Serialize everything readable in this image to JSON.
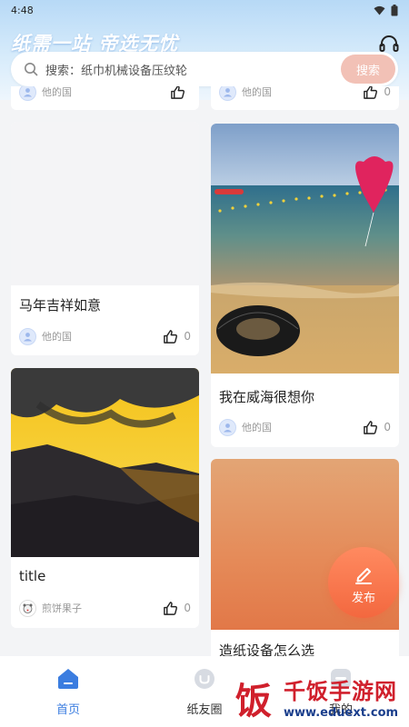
{
  "status_bar": {
    "time": "4:48"
  },
  "header": {
    "slogan": "纸需一站  帝选无忧"
  },
  "search": {
    "placeholder": "搜索：纸巾机械设备压纹轮",
    "button": "搜索"
  },
  "feed": {
    "cards": [
      {
        "title": "",
        "author": "他的国",
        "likes": ""
      },
      {
        "title": "",
        "author": "他的国",
        "likes": "0"
      },
      {
        "title": "马年吉祥如意",
        "author": "他的国",
        "likes": "0"
      },
      {
        "title": "我在威海很想你",
        "author": "他的国",
        "likes": "0"
      },
      {
        "title": "title",
        "author": "煎饼果子",
        "likes": "0"
      },
      {
        "title": "造纸设备怎么选"
      }
    ]
  },
  "fab": {
    "label": "发布"
  },
  "tabs": [
    {
      "label": "首页",
      "active": true,
      "color": "#3b7de0"
    },
    {
      "label": "纸友圈",
      "active": false
    },
    {
      "label": "我的",
      "active": false
    }
  ],
  "watermark": {
    "brand": "千饭手游网",
    "url": "www.eduext.com",
    "logo_char": "饭"
  },
  "colors": {
    "accent": "#3b7de0",
    "fab": "#f3683f",
    "search_button": "#f2c1b6"
  }
}
